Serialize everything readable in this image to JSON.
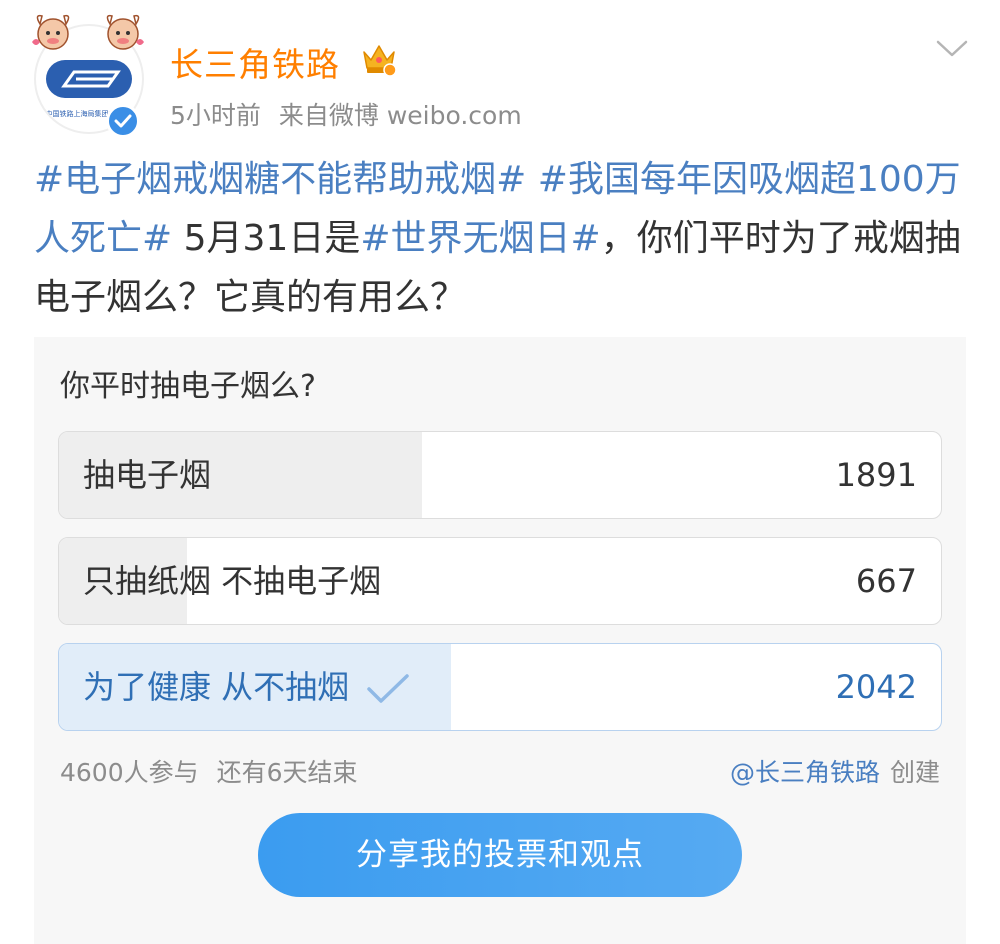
{
  "post": {
    "author": "长三角铁路",
    "time": "5小时前",
    "source": "来自微博 weibo.com",
    "text_segments": [
      {
        "text": "#电子烟戒烟糖不能帮助戒烟#",
        "type": "tag"
      },
      {
        "text": " ",
        "type": "plain"
      },
      {
        "text": "#我国每年因吸烟超100万人死亡#",
        "type": "tag"
      },
      {
        "text": " 5月31日是",
        "type": "plain"
      },
      {
        "text": "#世界无烟日#",
        "type": "tag"
      },
      {
        "text": "，你们平时为了戒烟抽电子烟么？它真的有用么？",
        "type": "plain"
      }
    ]
  },
  "poll": {
    "question": "你平时抽电子烟么?",
    "options": [
      {
        "label": "抽电子烟",
        "count": "1891",
        "share": 0.411,
        "selected": false
      },
      {
        "label": "只抽纸烟 不抽电子烟",
        "count": "667",
        "share": 0.145,
        "selected": false
      },
      {
        "label": "为了健康 从不抽烟",
        "count": "2042",
        "share": 0.444,
        "selected": true
      }
    ],
    "participants": "4600人参与",
    "remaining": "还有6天结束",
    "creator": "@长三角铁路",
    "created_label": "创建",
    "share_button": "分享我的投票和观点"
  },
  "colors": {
    "author": "#ff7f00",
    "tag": "#4a7fc1",
    "button": "#3b9cf0",
    "selected_fill": "#e1edf9"
  },
  "icons": [
    "mascot-icon",
    "railway-logo",
    "verified-icon",
    "crown-icon",
    "chevron-down-icon",
    "checkmark-icon"
  ]
}
